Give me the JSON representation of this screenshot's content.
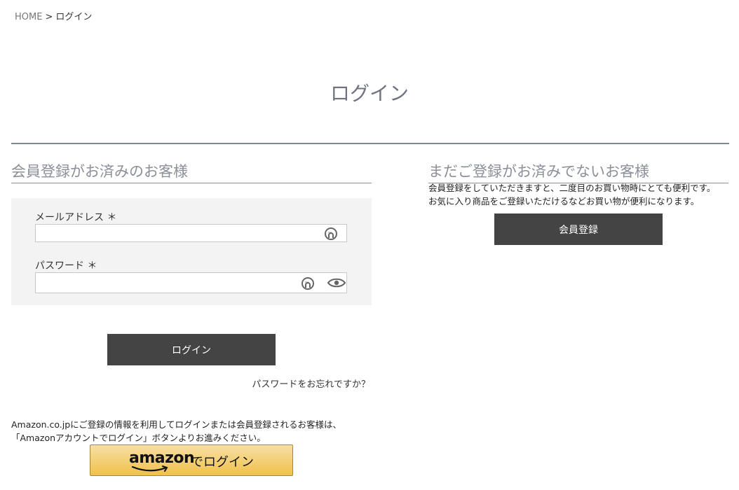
{
  "breadcrumb": {
    "home": "HOME",
    "separator": ">",
    "current": "ログイン"
  },
  "page_title": "ログイン",
  "member": {
    "section_title": "会員登録がお済みのお客様",
    "email_label": "メールアドレス ＊",
    "email_value": "",
    "password_label": "パスワード ＊",
    "password_value": "",
    "login_button": "ログイン",
    "forgot_link": "パスワードをお忘れですか？"
  },
  "guest": {
    "section_title": "まだご登録がお済みでないお客様",
    "description_line1": "会員登録をしていただきますと、二度目のお買い物時にとても便利です。",
    "description_line2": "お気に入り商品をご登録いただけるなどお買い物が便利になります。",
    "register_button": "会員登録"
  },
  "amazon": {
    "note_line1": "Amazon.co.jpにご登録の情報を利用してログインまたは会員登録されるお客様は、",
    "note_line2": "「Amazonアカウントでログイン」ボタンよりお進みください。",
    "logo_text": "amazon",
    "button_text": "でログイン"
  },
  "icons": {
    "autofill": "key-autofill-icon",
    "show_password": "eye-icon"
  },
  "colors": {
    "button_dark": "#444444",
    "amazon_gold": "#f0c14b",
    "title_gray": "#6f7480"
  }
}
